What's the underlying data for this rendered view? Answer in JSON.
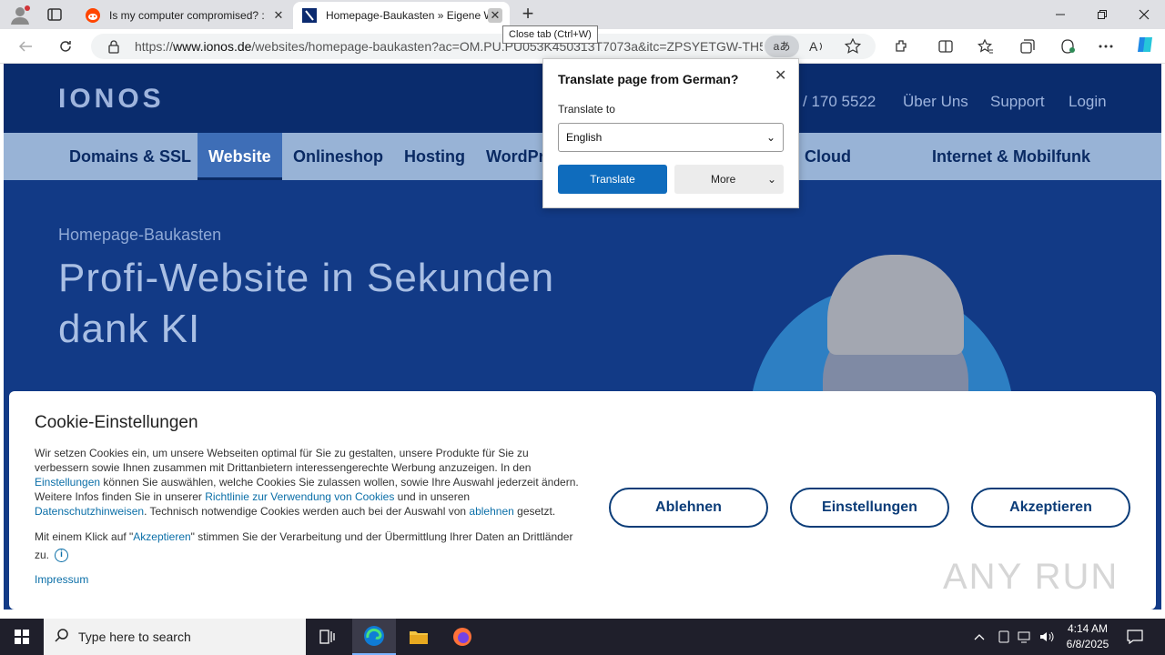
{
  "browser": {
    "tabs": [
      {
        "title": "Is my computer compromised? :",
        "icon": "reddit-icon"
      },
      {
        "title": "Homepage-Baukasten » Eigene W",
        "icon": "ionos-icon",
        "active": true
      }
    ],
    "tooltip": "Close tab (Ctrl+W)",
    "url_prefix": "https://",
    "url_host": "www.ionos.de",
    "url_path": "/websites/homepage-baukasten?ac=OM.PU.PU053K450313T7073a&itc=ZPSYETGW-TH5...",
    "translate_pill": "aあ"
  },
  "translate_popup": {
    "title": "Translate page from German?",
    "label": "Translate to",
    "selected_language": "English",
    "translate_button": "Translate",
    "more_button": "More"
  },
  "site": {
    "logo": "IONOS",
    "header_links": [
      "/ 170 5522",
      "Über Uns",
      "Support",
      "Login"
    ],
    "menu": [
      "Domains & SSL",
      "Website",
      "Onlineshop",
      "Hosting",
      "WordPr",
      "Cloud",
      "Internet & Mobilfunk"
    ],
    "active_menu": "Website",
    "kicker": "Homepage-Baukasten",
    "headline": "Profi-Website in Sekunden dank KI"
  },
  "cookie": {
    "title": "Cookie-Einstellungen",
    "p1_a": "Wir setzen Cookies ein, um unsere Webseiten optimal für Sie zu gestalten, unsere Produkte für Sie zu verbessern sowie Ihnen zusammen mit Drittanbietern interessengerechte Werbung anzuzeigen. In den ",
    "p1_link1": "Einstellungen",
    "p1_b": " können Sie auswählen, welche Cookies Sie zulassen wollen, sowie Ihre Auswahl jederzeit ändern. Weitere Infos finden Sie in unserer ",
    "p1_link2": "Richtlinie zur Verwendung von Cookies",
    "p1_c": " und in unseren ",
    "p1_link3": "Datenschutzhinweisen",
    "p1_d": ". Technisch notwendige Cookies werden auch bei der Auswahl von ",
    "p1_link4": "ablehnen",
    "p1_e": " gesetzt.",
    "p2_a": "Mit einem Klick auf \"",
    "p2_link": "Akzeptieren",
    "p2_b": "\" stimmen Sie der Verarbeitung und der Übermittlung Ihrer Daten an Drittländer zu.",
    "impressum": "Impressum",
    "btn_reject": "Ablehnen",
    "btn_settings": "Einstellungen",
    "btn_accept": "Akzeptieren"
  },
  "watermark": "ANY RUN",
  "taskbar": {
    "search_placeholder": "Type here to search",
    "time": "4:14 AM",
    "date": "6/8/2025"
  }
}
